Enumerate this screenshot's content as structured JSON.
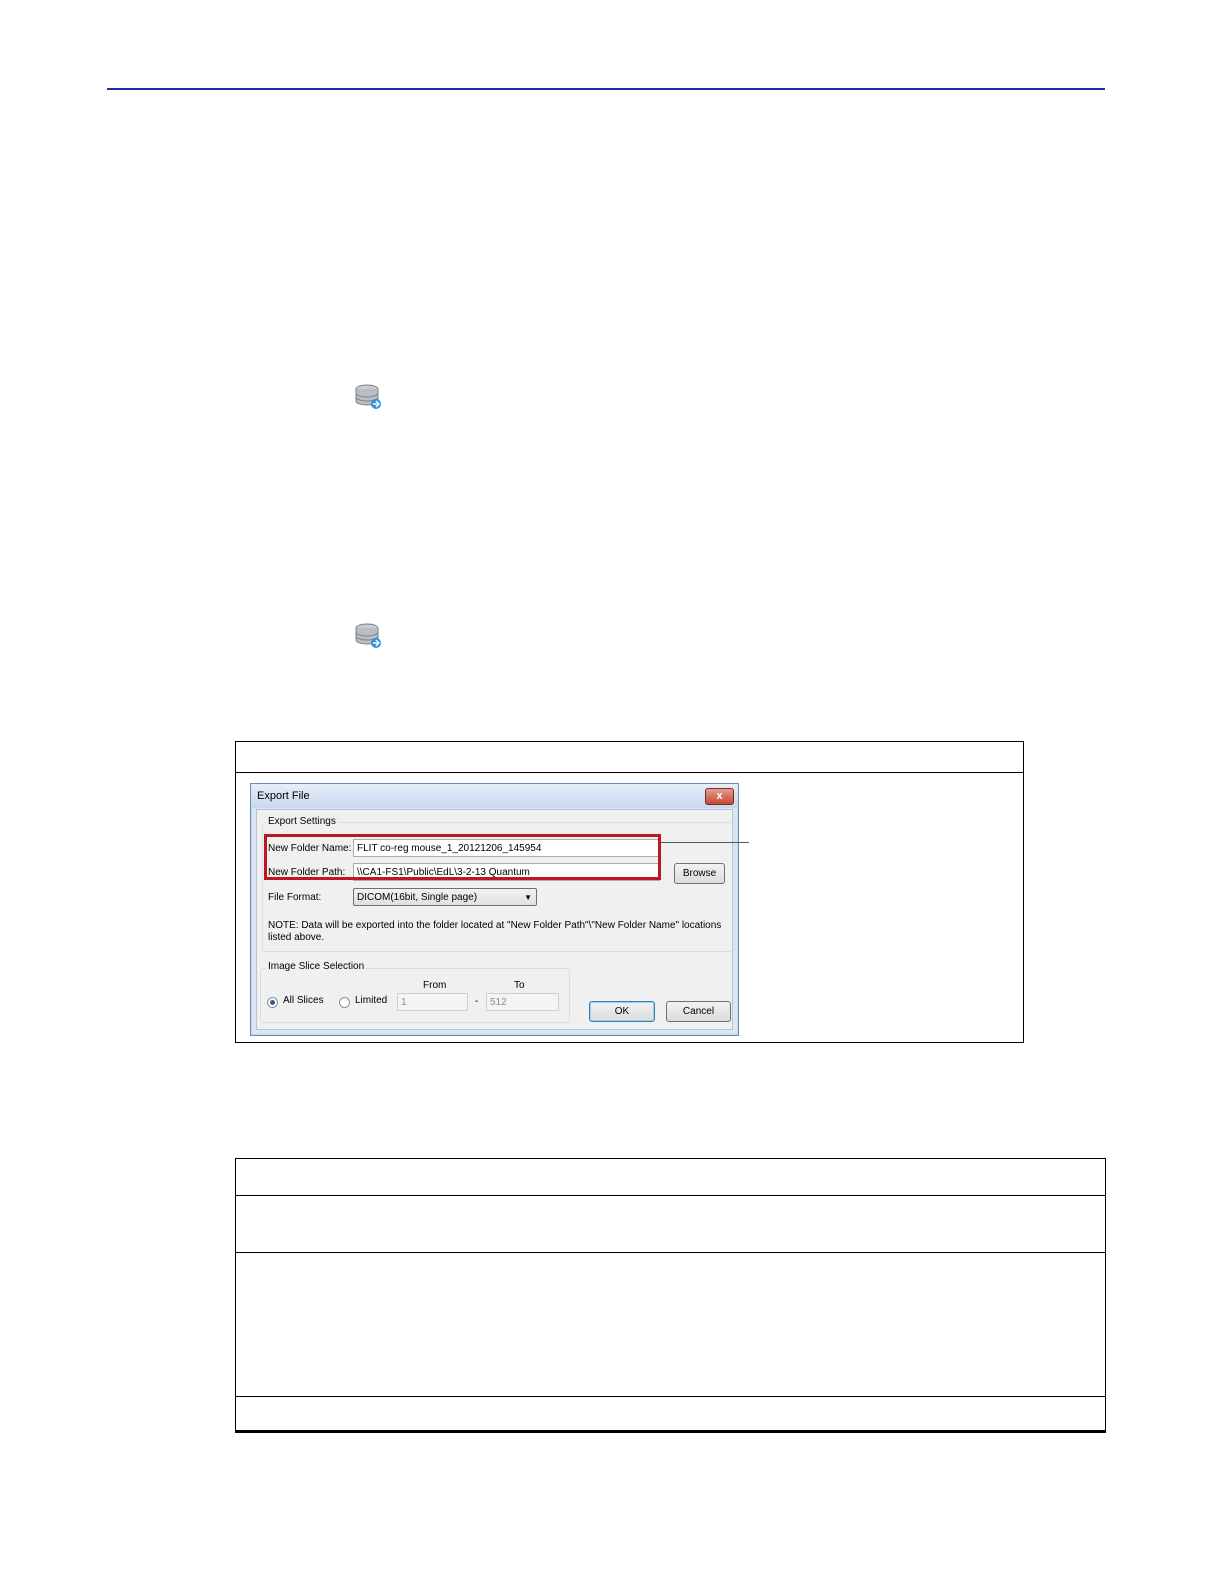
{
  "dialog": {
    "title": "Export File",
    "close_label": "x",
    "export_settings": {
      "group_label": "Export Settings",
      "folder_name_label": "New Folder Name:",
      "folder_name_value": "FLIT co-reg mouse_1_20121206_145954",
      "folder_path_label": "New Folder Path:",
      "folder_path_value": "\\\\CA1-FS1\\Public\\EdL\\3-2-13 Quantum",
      "browse_label": "Browse",
      "file_format_label": "File Format:",
      "file_format_value": "DICOM(16bit, Single page)",
      "note_line1": "NOTE: Data will be exported into the folder located at \"New Folder Path\"\\\"New Folder Name\" locations",
      "note_line2": "listed above."
    },
    "slice_selection": {
      "group_label": "Image Slice Selection",
      "from_label": "From",
      "to_label": "To",
      "all_slices_label": "All Slices",
      "limited_label": "Limited",
      "from_value": "1",
      "to_value": "512",
      "dash": "-",
      "selected": "All Slices"
    },
    "ok_label": "OK",
    "cancel_label": "Cancel"
  },
  "colors": {
    "header_rule": "#1f2f9e",
    "highlight": "#c0161f"
  },
  "icons": [
    "database-export-icon",
    "database-export-icon"
  ]
}
